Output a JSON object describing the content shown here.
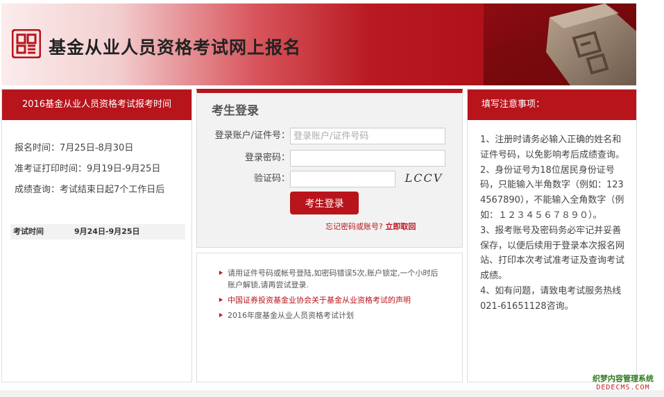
{
  "banner": {
    "title": "基金从业人员资格考试网上报名",
    "brand_color": "#b8141c"
  },
  "left_panel": {
    "heading": "2016基金从业人员资格考试报考时间",
    "schedule": [
      "报名时间：7月25日-8月30日",
      "准考证打印时间：9月19日-9月25日",
      "成绩查询：考试结束日起7个工作日后"
    ],
    "exam_label": "考试时间",
    "exam_dates": "9月24日-9月25日"
  },
  "login": {
    "title": "考生登录",
    "account_label": "登录账户/证件号：",
    "account_placeholder": "登录账户/证件号码",
    "password_label": "登录密码：",
    "captcha_label": "验证码：",
    "captcha_text": "LCCV",
    "submit_label": "考生登录",
    "forgot_text": "忘记密码或账号?",
    "forgot_link": "立即取回"
  },
  "news": [
    "请用证件号码或帐号登陆,如密码错误5次,账户锁定,一个小时后账户解锁,请再尝试登录.",
    "中国证券投资基金业协会关于基金从业资格考试的声明",
    "2016年度基金从业人员资格考试计划"
  ],
  "right_panel": {
    "heading": "填写注意事项：",
    "notes": [
      "1、注册时请务必输入正确的姓名和证件号码，以免影响考后成绩查询。",
      "2、身份证号为18位居民身份证号码，只能输入半角数字（例如：1234567890），不能输入全角数字（例如：１２３４５６７８９０）。",
      "3、报考账号及密码务必牢记并妥善保存，以便后续用于登录本次报名网站、打印本次考试准考证及查询考试成绩。",
      "4、如有问题，请致电考试服务热线021-61651128咨询。"
    ]
  },
  "watermark": {
    "line1": "织梦内容管理系统",
    "line2": "DEDECMS.COM"
  }
}
